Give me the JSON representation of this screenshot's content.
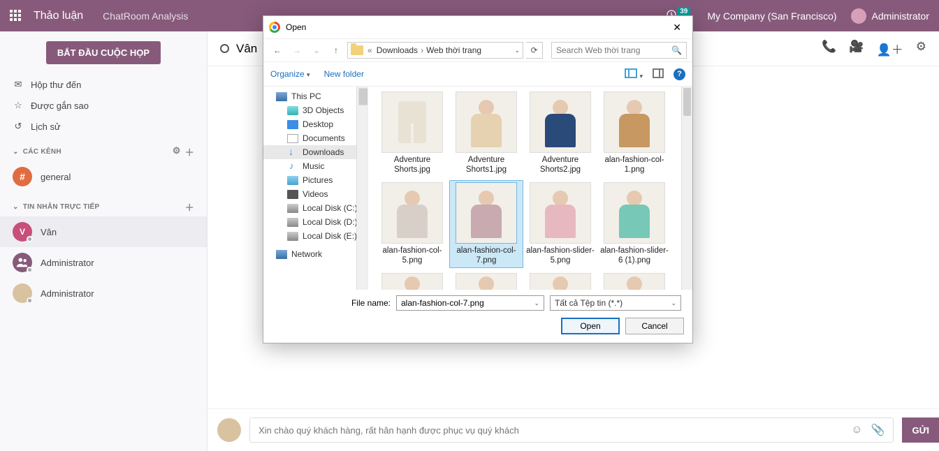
{
  "topbar": {
    "title": "Thảo luận",
    "subtitle": "ChatRoom Analysis",
    "notif_count": "39",
    "company": "My Company (San Francisco)",
    "user": "Administrator"
  },
  "sidebar": {
    "start_button": "BẮT ĐẦU CUỘC HỌP",
    "nav": {
      "inbox": "Hộp thư đến",
      "starred": "Được gắn sao",
      "history": "Lịch sử"
    },
    "sections": {
      "channels": "CÁC KÊNH",
      "dm": "TIN NHẮN TRỰC TIẾP"
    },
    "channel_general": "general",
    "dm_items": [
      "Vân",
      "Administrator",
      "Administrator"
    ]
  },
  "chat": {
    "header_name": "Vân",
    "input_placeholder": "Xin chào quý khách hàng, rất hân hạnh được phục vụ quý khách",
    "send": "GỬI"
  },
  "dialog": {
    "title": "Open",
    "crumbs": {
      "level1": "Downloads",
      "level2": "Web thời trang"
    },
    "search_placeholder": "Search Web thời trang",
    "toolbar": {
      "organize": "Organize",
      "newfolder": "New folder"
    },
    "tree": {
      "thispc": "This PC",
      "objects": "3D Objects",
      "desktop": "Desktop",
      "documents": "Documents",
      "downloads": "Downloads",
      "music": "Music",
      "pictures": "Pictures",
      "videos": "Videos",
      "diskc": "Local Disk (C:)",
      "diskd": "Local Disk (D:)",
      "diske": "Local Disk (E:)",
      "network": "Network"
    },
    "files": [
      {
        "name": "Adventure Shorts.jpg",
        "color": "#e8e2d5",
        "sel": false,
        "type": "shorts"
      },
      {
        "name": "Adventure Shorts1.jpg",
        "color": "#e6d2b0",
        "sel": false,
        "type": "person"
      },
      {
        "name": "Adventure Shorts2.jpg",
        "color": "#2a4a7a",
        "sel": false,
        "type": "person"
      },
      {
        "name": "alan-fashion-col-1.png",
        "color": "#c79862",
        "sel": false,
        "type": "person"
      },
      {
        "name": "alan-fashion-col-5.png",
        "color": "#d8d0c8",
        "sel": false,
        "type": "person"
      },
      {
        "name": "alan-fashion-col-7.png",
        "color": "#c8aab0",
        "sel": true,
        "type": "person"
      },
      {
        "name": "alan-fashion-slider-5.png",
        "color": "#e8b8c0",
        "sel": false,
        "type": "person"
      },
      {
        "name": "alan-fashion-slider-6 (1).png",
        "color": "#78c8b8",
        "sel": false,
        "type": "person"
      }
    ],
    "partial_color": "#b8a890",
    "footer": {
      "fn_label": "File name:",
      "fn_value": "alan-fashion-col-7.png",
      "filter": "Tất cả Tệp tin (*.*)",
      "open": "Open",
      "cancel": "Cancel"
    }
  }
}
